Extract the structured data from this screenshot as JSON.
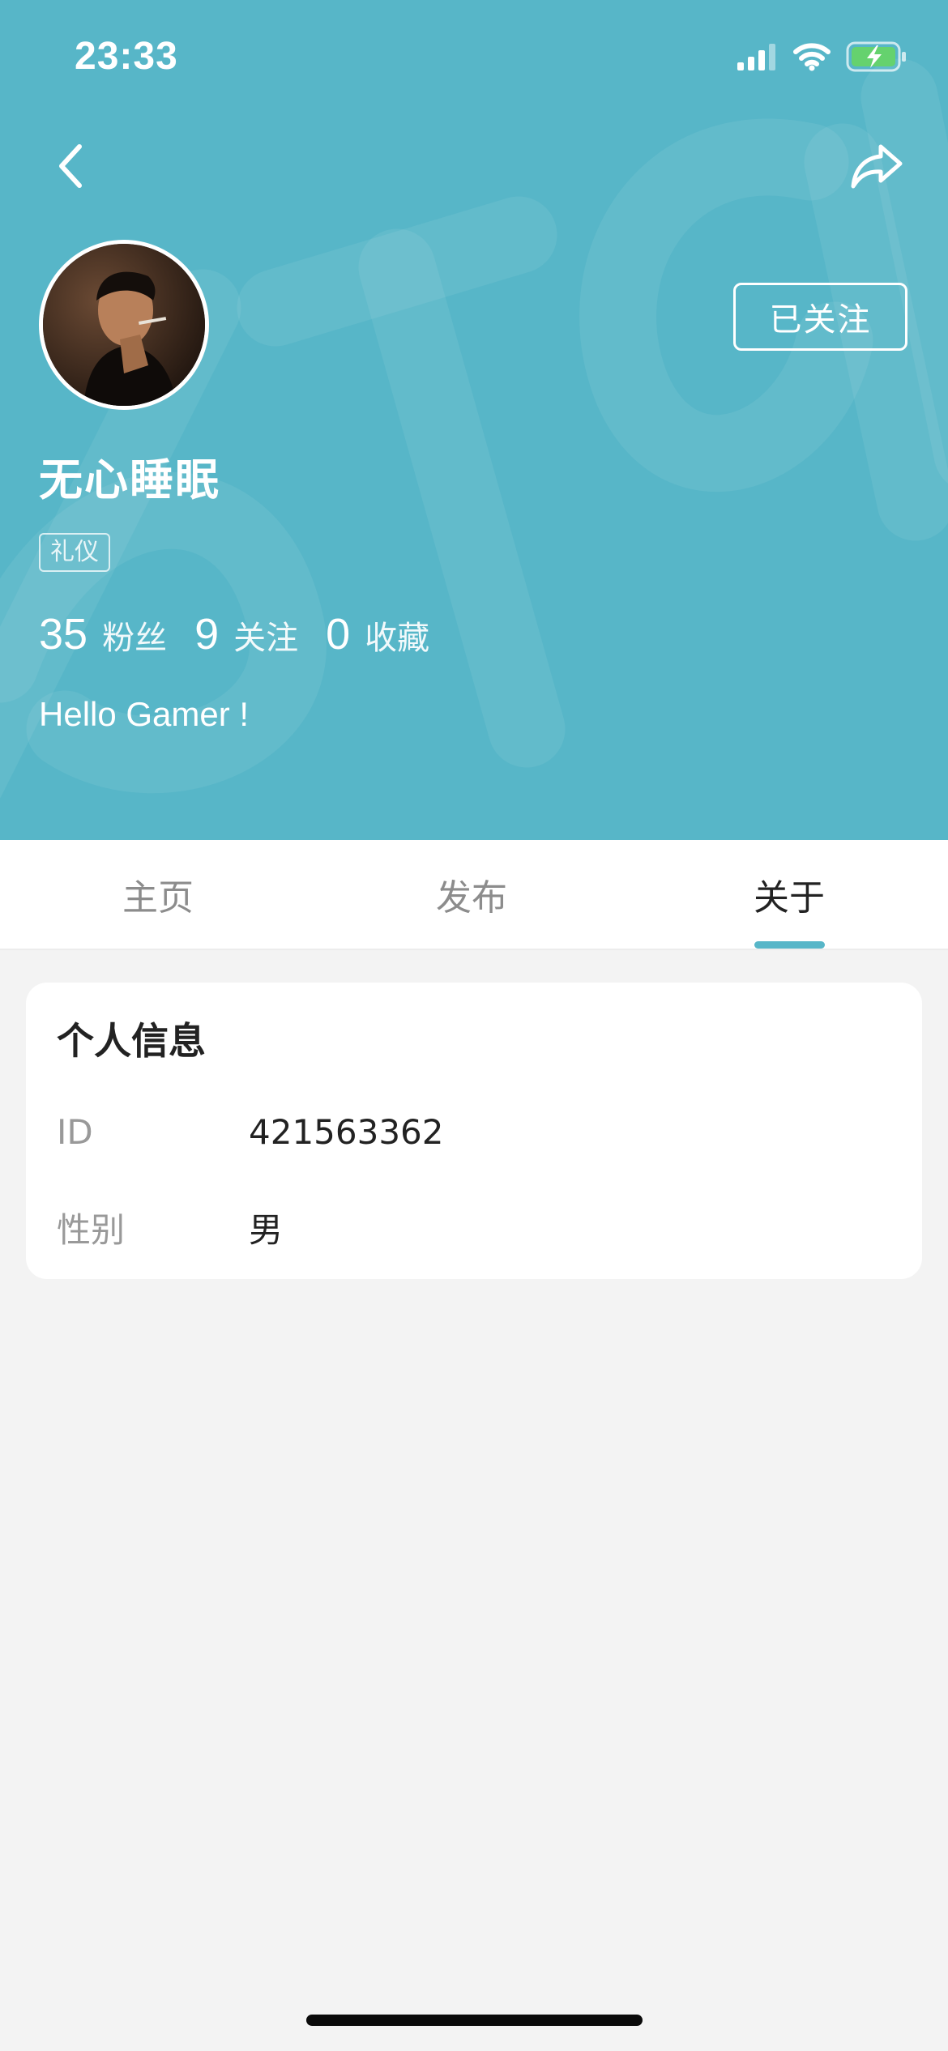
{
  "status_bar": {
    "time": "23:33",
    "icons": [
      "signal-icon",
      "wifi-icon",
      "battery-charging-icon"
    ]
  },
  "header": {
    "background_color": "#57b6c8",
    "follow_label": "已关注",
    "username": "无心睡眠",
    "tag": "礼仪",
    "stats": [
      {
        "count": "35",
        "label": "粉丝"
      },
      {
        "count": "9",
        "label": "关注"
      },
      {
        "count": "0",
        "label": "收藏"
      }
    ],
    "bio": "Hello Gamer !"
  },
  "tabs": [
    {
      "label": "主页",
      "active": false
    },
    {
      "label": "发布",
      "active": false
    },
    {
      "label": "关于",
      "active": true
    }
  ],
  "info": {
    "title": "个人信息",
    "rows": [
      {
        "label": "ID",
        "value": "421563362"
      },
      {
        "label": "性别",
        "value": "男"
      }
    ]
  },
  "accent_color": "#57b6c8"
}
